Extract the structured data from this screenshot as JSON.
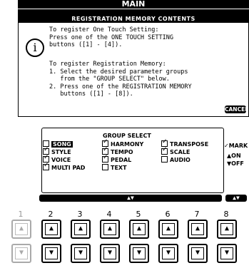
{
  "screen": {
    "title": "MAIN"
  },
  "dialog": {
    "title": "REGISTRATION MEMORY CONTENTS",
    "icon": "info-icon",
    "paragraph1": [
      "To register One Touch Setting:",
      "Press one of the ONE TOUCH SETTING",
      "buttons ([1] - [4])."
    ],
    "paragraph2": [
      "To register Registration Memory:",
      "1. Select the desired parameter groups",
      "   from the \"GROUP SELECT\" below.",
      "2. Press one of the REGISTRATION MEMORY",
      "   buttons ([1] - [8])."
    ],
    "cancel_label": "CANCEL"
  },
  "group_select": {
    "title": "GROUP SELECT",
    "items": [
      {
        "label": "SONG",
        "checked": false,
        "selected": true
      },
      {
        "label": "STYLE",
        "checked": true,
        "selected": false
      },
      {
        "label": "VOICE",
        "checked": true,
        "selected": false
      },
      {
        "label": "MULTI PAD",
        "checked": true,
        "selected": false
      },
      {
        "label": "HARMONY",
        "checked": true,
        "selected": false
      },
      {
        "label": "TEMPO",
        "checked": true,
        "selected": false
      },
      {
        "label": "PEDAL",
        "checked": true,
        "selected": false
      },
      {
        "label": "TEXT",
        "checked": false,
        "selected": false
      },
      {
        "label": "TRANSPOSE",
        "checked": true,
        "selected": false
      },
      {
        "label": "SCALE",
        "checked": true,
        "selected": false
      },
      {
        "label": "AUDIO",
        "checked": false,
        "selected": false
      }
    ],
    "legend": {
      "mark": "✓MARK",
      "on": "▲ON",
      "off": "▼OFF"
    },
    "scroll_arrows": "▲▼",
    "side_arrows": "▲▼"
  },
  "buttons": {
    "numbers": [
      "1",
      "2",
      "3",
      "4",
      "5",
      "6",
      "7",
      "8"
    ],
    "up_glyph": "▲",
    "down_glyph": "▼"
  }
}
